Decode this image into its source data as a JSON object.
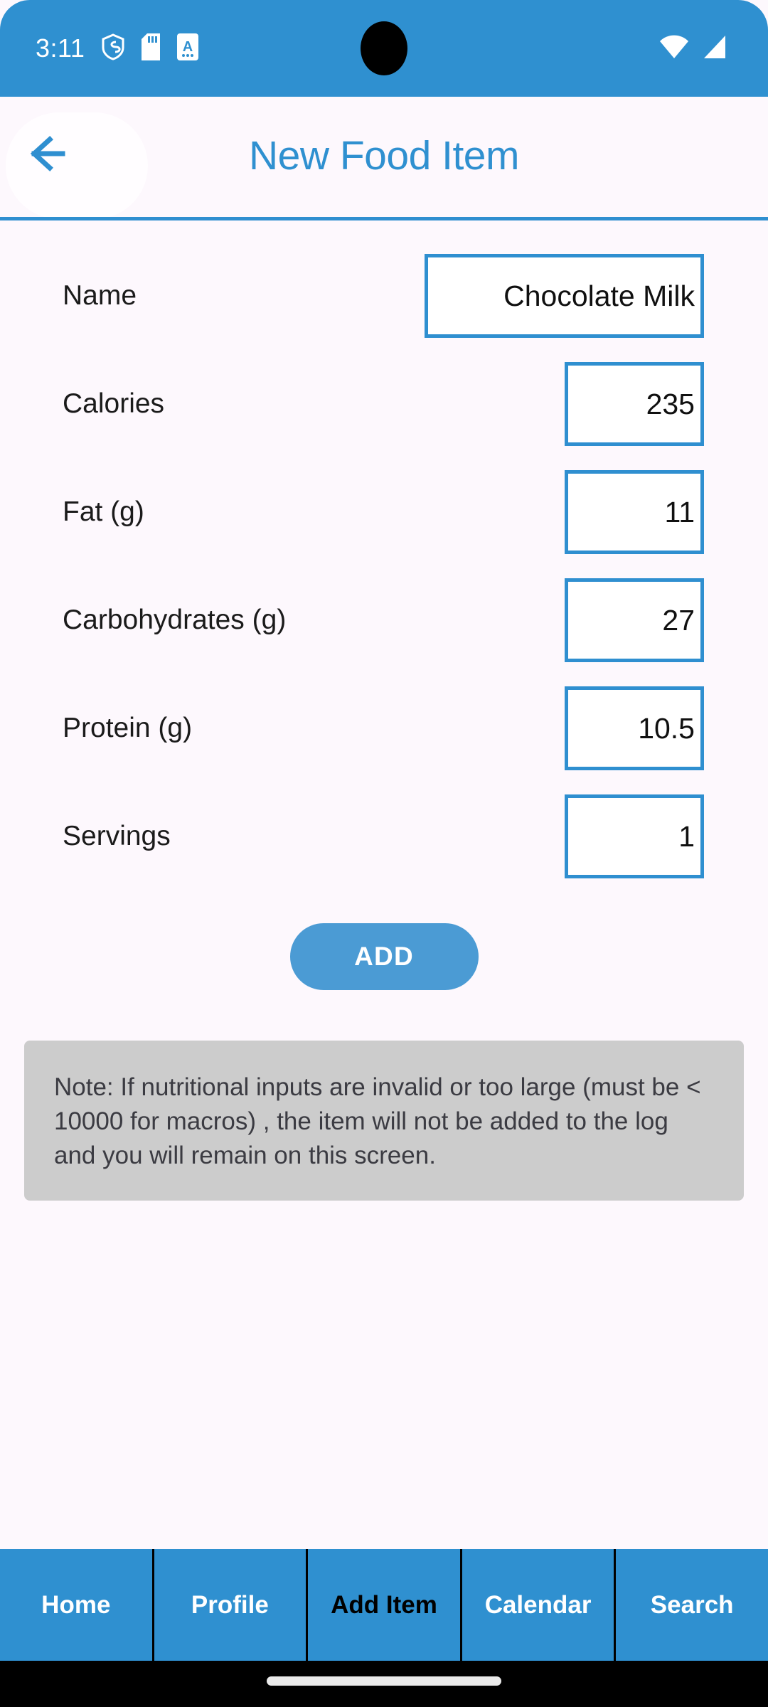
{
  "status_bar": {
    "clock": "3:11",
    "left_icons": [
      "shield-icon",
      "sd-card-icon",
      "a-badge-icon"
    ],
    "right_icons": [
      "wifi-icon",
      "cell-signal-icon"
    ],
    "background_color": "#2f90d0"
  },
  "app_bar": {
    "back_label": "back-arrow",
    "title": "New Food Item",
    "title_color": "#2f90d0",
    "background_color": "#fdf8fd",
    "divider_color": "#2f8fd0"
  },
  "form": {
    "rows": [
      {
        "label": "Name",
        "value": "Chocolate Milk",
        "width": "wide",
        "name": "name"
      },
      {
        "label": "Calories",
        "value": "235",
        "width": "narrow",
        "name": "calories"
      },
      {
        "label": "Fat (g)",
        "value": "11",
        "width": "narrow",
        "name": "fat"
      },
      {
        "label": "Carbohydrates (g)",
        "value": "27",
        "width": "narrow",
        "name": "carbohydrates"
      },
      {
        "label": "Protein (g)",
        "value": "10.5",
        "width": "narrow",
        "name": "protein"
      },
      {
        "label": "Servings",
        "value": "1",
        "width": "narrow",
        "name": "servings"
      }
    ],
    "field_border_color": "#2f8fd0"
  },
  "add_button": {
    "label": "ADD",
    "background_color": "#4b9bd4"
  },
  "note": {
    "text": "Note: If nutritional inputs are invalid or too large (must be < 10000 for macros) , the item will not be added to the log and you will remain on this screen.",
    "background_color": "#cccccc"
  },
  "bottom_nav": {
    "background_color": "#2f90d0",
    "active_index": 2,
    "tabs": [
      {
        "label": "Home"
      },
      {
        "label": "Profile"
      },
      {
        "label": "Add Item"
      },
      {
        "label": "Calendar"
      },
      {
        "label": "Search"
      }
    ]
  }
}
